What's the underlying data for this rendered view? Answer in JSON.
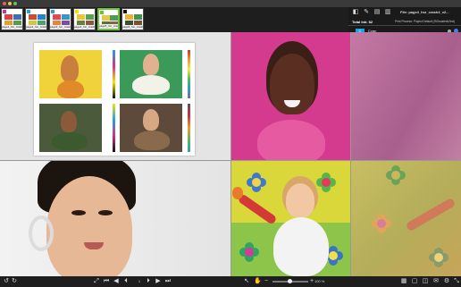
{
  "window": {
    "controls": [
      "close",
      "minimize",
      "zoom"
    ]
  },
  "thumbnails": [
    {
      "caption": "page1_hsr_crash",
      "selected": false
    },
    {
      "caption": "page2_hsr_crash",
      "selected": false
    },
    {
      "caption": "page3_hsr_crash",
      "selected": false
    },
    {
      "caption": "page4_hsr_crash",
      "selected": false
    },
    {
      "caption": "page5_hsr_crash",
      "selected": true
    },
    {
      "caption": "page6_hsr_crash",
      "selected": false
    }
  ],
  "panel": {
    "file_label": "File: page4_hsr_crash4_v2...",
    "total_ink_label": "Total Ink: 82",
    "profile_label": "Print Process: Project Default (ISOcoatedv2eci)",
    "inks": [
      {
        "letter": "C",
        "name": "Cyan",
        "color": "#1aa3e6"
      },
      {
        "letter": "M",
        "name": "Magenta",
        "color": "#d82f8a"
      },
      {
        "letter": "Y",
        "name": "Yellow",
        "color": "#f2e600"
      },
      {
        "letter": "K",
        "name": "Black",
        "color": "#111111"
      }
    ]
  },
  "toolbar": {
    "page_number": "1",
    "zoom_value": "100 %"
  },
  "colors": {
    "accent_select": "#6fc13a",
    "magenta_bg": "#d43a8d",
    "yellow_bg": "#e5e23a"
  }
}
